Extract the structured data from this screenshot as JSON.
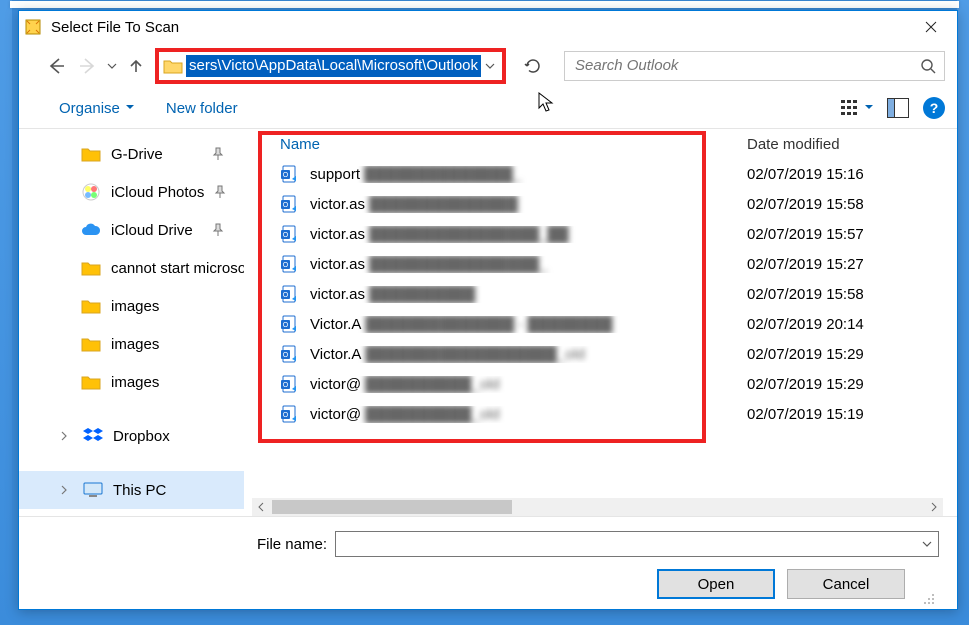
{
  "title": "Select File To Scan",
  "address_path": "sers\\Victo\\AppData\\Local\\Microsoft\\Outlook",
  "search": {
    "placeholder": "Search Outlook"
  },
  "toolbar": {
    "organise": "Organise",
    "newfolder": "New folder"
  },
  "sidebar": {
    "items": [
      {
        "key": "gdrive",
        "label": "G-Drive",
        "pinned": true,
        "color": "#ffc107"
      },
      {
        "key": "icphotos",
        "label": "iCloud Photos",
        "pinned": true,
        "color": "multi"
      },
      {
        "key": "icdrive",
        "label": "iCloud Drive",
        "pinned": true,
        "color": "#2b93f2"
      },
      {
        "key": "cannot",
        "label": "cannot start microsoft outlook",
        "pinned": false,
        "color": "#ffc107"
      },
      {
        "key": "images1",
        "label": "images",
        "pinned": false,
        "color": "#ffc107"
      },
      {
        "key": "images2",
        "label": "images",
        "pinned": false,
        "color": "#ffc107"
      },
      {
        "key": "images3",
        "label": "images",
        "pinned": false,
        "color": "#ffc107"
      }
    ],
    "dropbox": "Dropbox",
    "thispc": "This PC"
  },
  "columns": {
    "name": "Name",
    "date": "Date modified"
  },
  "files": [
    {
      "prefix": "support",
      "blur": "██████████████_",
      "modified": "02/07/2019 15:16"
    },
    {
      "prefix": "victor.as",
      "blur": "██████████████",
      "modified": "02/07/2019 15:58"
    },
    {
      "prefix": "victor.as",
      "blur": "████████████████_██",
      "modified": "02/07/2019 15:57"
    },
    {
      "prefix": "victor.as",
      "blur": "████████████████_",
      "modified": "02/07/2019 15:27"
    },
    {
      "prefix": "victor.as",
      "blur": "██████████",
      "modified": "02/07/2019 15:58"
    },
    {
      "prefix": "Victor.A",
      "blur": "██████████████ - ████████",
      "modified": "02/07/2019 20:14"
    },
    {
      "prefix": "Victor.A",
      "blur": "██████████████████_old",
      "modified": "02/07/2019 15:29"
    },
    {
      "prefix": "victor@",
      "blur": "██████████_old",
      "modified": "02/07/2019 15:29"
    },
    {
      "prefix": "victor@",
      "blur": "██████████_old",
      "modified": "02/07/2019 15:19"
    }
  ],
  "chart_data": {
    "type": "table",
    "columns": [
      "Name",
      "Date modified"
    ],
    "rows": [
      [
        "support████████████████████_",
        "02/07/2019 15:16"
      ],
      [
        "victor.as██████████████",
        "02/07/2019 15:58"
      ],
      [
        "victor.as████████████████_██",
        "02/07/2019 15:57"
      ],
      [
        "victor.as████████████████_",
        "02/07/2019 15:27"
      ],
      [
        "victor.as██████████",
        "02/07/2019 15:58"
      ],
      [
        "Victor.A██████████████ - ████████",
        "02/07/2019 20:14"
      ],
      [
        "Victor.A██████████████████_old",
        "02/07/2019 15:29"
      ],
      [
        "victor@██████████_old",
        "02/07/2019 15:29"
      ],
      [
        "victor@██████████_old",
        "02/07/2019 15:19"
      ]
    ]
  },
  "footer": {
    "filename_label": "File name:",
    "open": "Open",
    "cancel": "Cancel"
  }
}
